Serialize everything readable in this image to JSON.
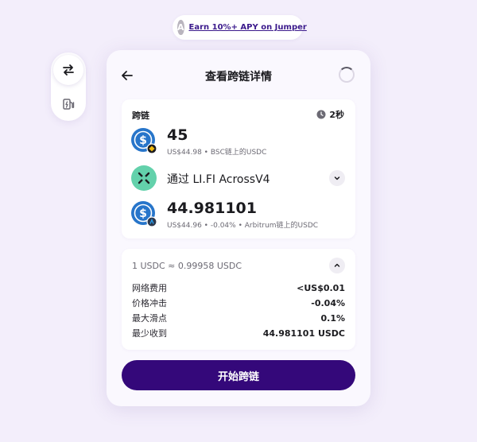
{
  "promo": {
    "badge": "A",
    "link_text": "Earn 10%+ APY on Jumper"
  },
  "sidenav": {
    "items": [
      {
        "icon": "swap-arrows-icon",
        "active": true
      },
      {
        "icon": "gas-pump-icon",
        "active": false
      }
    ]
  },
  "header": {
    "title": "查看跨链详情"
  },
  "route": {
    "label": "跨链",
    "duration": "2秒",
    "from": {
      "amount": "45",
      "usd": "US$44.98",
      "network": "BSC链上的USDC"
    },
    "via": {
      "text": "通过 LI.FI AcrossV4"
    },
    "to": {
      "amount": "44.981101",
      "usd": "US$44.96",
      "impact": "-0.04%",
      "network": "Arbitrum链上的USDC"
    }
  },
  "details": {
    "rate": "1 USDC ≈ 0.99958 USDC",
    "rows": [
      {
        "label": "网络费用",
        "value": "<US$0.01"
      },
      {
        "label": "价格冲击",
        "value": "-0.04%"
      },
      {
        "label": "最大滑点",
        "value": "0.1%"
      },
      {
        "label": "最少收到",
        "value": "44.981101 USDC"
      }
    ]
  },
  "cta": {
    "label": "开始跨链"
  },
  "colors": {
    "background": "#f3eefb",
    "primary": "#34087a",
    "usdc": "#2775ca",
    "lifi": "#63d1ab",
    "bnb": "#f0b90b",
    "arbitrum": "#2d374b"
  },
  "separator": "•"
}
